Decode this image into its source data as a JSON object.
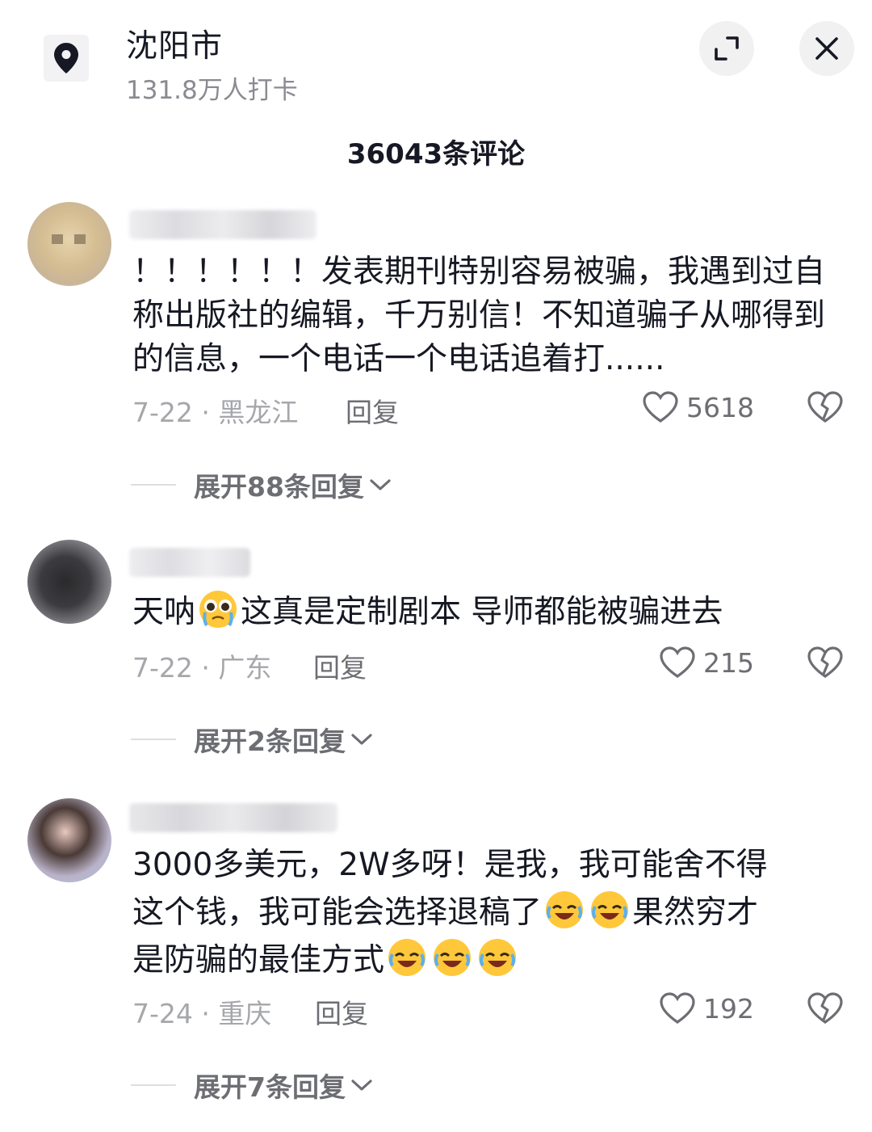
{
  "header": {
    "location_name": "沈阳市",
    "checkins": "131.8万人打卡",
    "comment_count": "36043条评论"
  },
  "comments": [
    {
      "text": "！！！！！！发表期刊特别容易被骗，我遇到过自称出版社的编辑，千万别信！不知道骗子从哪得到的信息，一个电话一个电话追着打......",
      "date_region": "7-22 · 黑龙江",
      "reply_label": "回复",
      "likes": "5618",
      "expand_label": "展开88条回复"
    },
    {
      "text_before_emoji": "天呐",
      "text_after_emoji": "这真是定制剧本 导师都能被骗进去",
      "emoji": "pleading-cry-emoji",
      "date_region": "7-22 · 广东",
      "reply_label": "回复",
      "likes": "215",
      "expand_label": "展开2条回复"
    },
    {
      "line1": "3000多美元，2W多呀！是我，我可能舍不得",
      "line2_a": "这个钱，我可能会选择退稿了",
      "line2_b": "果然穷才",
      "line3": "是防骗的最佳方式",
      "emoji": "rofl-emoji",
      "date_region": "7-24 · 重庆",
      "reply_label": "回复",
      "likes": "192",
      "expand_label": "展开7条回复"
    }
  ],
  "colors": {
    "text_primary": "#161823",
    "text_secondary": "#8a8b91",
    "text_meta": "#a6a7ab",
    "icon_bg": "#f1f1f2"
  },
  "icons": [
    "location-pin-icon",
    "expand-icon",
    "close-icon",
    "heart-icon",
    "broken-heart-icon",
    "chevron-down-icon"
  ]
}
